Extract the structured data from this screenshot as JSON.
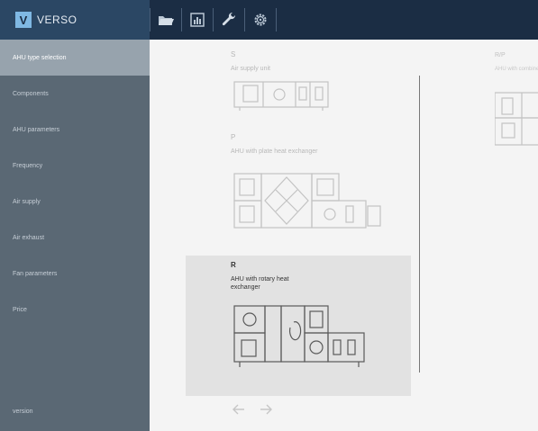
{
  "app": {
    "logo_letter": "V",
    "name": "VERSO"
  },
  "toolbar": {
    "tools": [
      "folder-icon",
      "chart-icon",
      "wrench-icon",
      "gear-icon"
    ]
  },
  "sidebar": {
    "items": [
      {
        "label": "AHU type selection",
        "active": true
      },
      {
        "label": "Components",
        "active": false
      },
      {
        "label": "AHU parameters",
        "active": false
      },
      {
        "label": "Frequency",
        "active": false
      },
      {
        "label": "Air supply",
        "active": false
      },
      {
        "label": "Air exhaust",
        "active": false
      },
      {
        "label": "Fan parameters",
        "active": false
      },
      {
        "label": "Price",
        "active": false
      }
    ],
    "footer": "version"
  },
  "types": [
    {
      "code": "S",
      "description": "Air supply unit",
      "selected": false
    },
    {
      "code": "P",
      "description": "AHU with plate heat exchanger",
      "selected": false
    },
    {
      "code": "R",
      "description": "AHU with rotary heat exchanger",
      "selected": true
    }
  ],
  "type_partial": {
    "code": "R/P",
    "description": "AHU with combined"
  },
  "colors": {
    "topbar": "#1b2d44",
    "logo_bg": "#2b4764",
    "sidebar": "#5a6874",
    "sidebar_active": "#97a3ad",
    "content_bg": "#f4f4f4",
    "selected_card": "#e2e2e2"
  }
}
